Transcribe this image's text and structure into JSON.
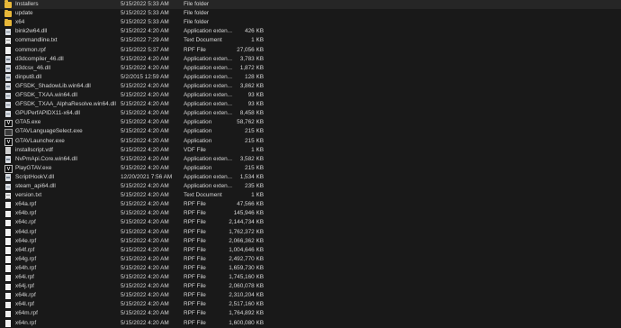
{
  "files": [
    {
      "name": "Installers",
      "date": "5/15/2022 5:33 AM",
      "type": "File folder",
      "size": "",
      "icon": "folder-icon"
    },
    {
      "name": "update",
      "date": "5/15/2022 5:33 AM",
      "type": "File folder",
      "size": "",
      "icon": "folder-icon"
    },
    {
      "name": "x64",
      "date": "5/15/2022 5:33 AM",
      "type": "File folder",
      "size": "",
      "icon": "folder-icon"
    },
    {
      "name": "bink2w64.dll",
      "date": "5/15/2022 4:20 AM",
      "type": "Application exten...",
      "size": "426 KB",
      "icon": "dll-file-icon"
    },
    {
      "name": "commandline.txt",
      "date": "5/15/2022 7:29 AM",
      "type": "Text Document",
      "size": "1 KB",
      "icon": "text-file-icon"
    },
    {
      "name": "common.rpf",
      "date": "5/15/2022 5:37 AM",
      "type": "RPF File",
      "size": "27,056 KB",
      "icon": "rpf-file-icon"
    },
    {
      "name": "d3dcompiler_46.dll",
      "date": "5/15/2022 4:20 AM",
      "type": "Application exten...",
      "size": "3,783 KB",
      "icon": "dll-file-icon"
    },
    {
      "name": "d3dcsx_46.dll",
      "date": "5/15/2022 4:20 AM",
      "type": "Application exten...",
      "size": "1,872 KB",
      "icon": "dll-file-icon"
    },
    {
      "name": "dinput8.dll",
      "date": "5/2/2015 12:59 AM",
      "type": "Application exten...",
      "size": "128 KB",
      "icon": "dll-file-icon"
    },
    {
      "name": "GFSDK_ShadowLib.win64.dll",
      "date": "5/15/2022 4:20 AM",
      "type": "Application exten...",
      "size": "3,862 KB",
      "icon": "dll-file-icon"
    },
    {
      "name": "GFSDK_TXAA.win64.dll",
      "date": "5/15/2022 4:20 AM",
      "type": "Application exten...",
      "size": "93 KB",
      "icon": "dll-file-icon"
    },
    {
      "name": "GFSDK_TXAA_AlphaResolve.win64.dll",
      "date": "5/15/2022 4:20 AM",
      "type": "Application exten...",
      "size": "93 KB",
      "icon": "dll-file-icon"
    },
    {
      "name": "GPUPerfAPIDX11-x64.dll",
      "date": "5/15/2022 4:20 AM",
      "type": "Application exten...",
      "size": "8,458 KB",
      "icon": "dll-file-icon"
    },
    {
      "name": "GTA5.exe",
      "date": "5/15/2022 4:20 AM",
      "type": "Application",
      "size": "58,762 KB",
      "icon": "gta-app-icon"
    },
    {
      "name": "GTAVLanguageSelect.exe",
      "date": "5/15/2022 4:20 AM",
      "type": "Application",
      "size": "215 KB",
      "icon": "exe-file-icon"
    },
    {
      "name": "GTAVLauncher.exe",
      "date": "5/15/2022 4:20 AM",
      "type": "Application",
      "size": "215 KB",
      "icon": "gta-app-icon"
    },
    {
      "name": "installscript.vdf",
      "date": "5/15/2022 4:20 AM",
      "type": "VDF File",
      "size": "1 KB",
      "icon": "vdf-file-icon"
    },
    {
      "name": "NvPmApi.Core.win64.dll",
      "date": "5/15/2022 4:20 AM",
      "type": "Application exten...",
      "size": "3,582 KB",
      "icon": "dll-file-icon"
    },
    {
      "name": "PlayGTAV.exe",
      "date": "5/15/2022 4:20 AM",
      "type": "Application",
      "size": "215 KB",
      "icon": "gta-app-icon"
    },
    {
      "name": "ScriptHookV.dll",
      "date": "12/20/2021 7:56 AM",
      "type": "Application exten...",
      "size": "1,534 KB",
      "icon": "dll-file-icon"
    },
    {
      "name": "steam_api64.dll",
      "date": "5/15/2022 4:20 AM",
      "type": "Application exten...",
      "size": "235 KB",
      "icon": "dll-file-icon"
    },
    {
      "name": "version.txt",
      "date": "5/15/2022 4:20 AM",
      "type": "Text Document",
      "size": "1 KB",
      "icon": "text-file-icon"
    },
    {
      "name": "x64a.rpf",
      "date": "5/15/2022 4:20 AM",
      "type": "RPF File",
      "size": "47,566 KB",
      "icon": "rpf-file-icon"
    },
    {
      "name": "x64b.rpf",
      "date": "5/15/2022 4:20 AM",
      "type": "RPF File",
      "size": "145,946 KB",
      "icon": "rpf-file-icon"
    },
    {
      "name": "x64c.rpf",
      "date": "5/15/2022 4:20 AM",
      "type": "RPF File",
      "size": "2,144,734 KB",
      "icon": "rpf-file-icon"
    },
    {
      "name": "x64d.rpf",
      "date": "5/15/2022 4:20 AM",
      "type": "RPF File",
      "size": "1,762,372 KB",
      "icon": "rpf-file-icon"
    },
    {
      "name": "x64e.rpf",
      "date": "5/15/2022 4:20 AM",
      "type": "RPF File",
      "size": "2,066,362 KB",
      "icon": "rpf-file-icon"
    },
    {
      "name": "x64f.rpf",
      "date": "5/15/2022 4:20 AM",
      "type": "RPF File",
      "size": "1,004,646 KB",
      "icon": "rpf-file-icon"
    },
    {
      "name": "x64g.rpf",
      "date": "5/15/2022 4:20 AM",
      "type": "RPF File",
      "size": "2,492,770 KB",
      "icon": "rpf-file-icon"
    },
    {
      "name": "x64h.rpf",
      "date": "5/15/2022 4:20 AM",
      "type": "RPF File",
      "size": "1,659,730 KB",
      "icon": "rpf-file-icon"
    },
    {
      "name": "x64i.rpf",
      "date": "5/15/2022 4:20 AM",
      "type": "RPF File",
      "size": "1,745,160 KB",
      "icon": "rpf-file-icon"
    },
    {
      "name": "x64j.rpf",
      "date": "5/15/2022 4:20 AM",
      "type": "RPF File",
      "size": "2,060,078 KB",
      "icon": "rpf-file-icon"
    },
    {
      "name": "x64k.rpf",
      "date": "5/15/2022 4:20 AM",
      "type": "RPF File",
      "size": "2,310,204 KB",
      "icon": "rpf-file-icon"
    },
    {
      "name": "x64l.rpf",
      "date": "5/15/2022 4:20 AM",
      "type": "RPF File",
      "size": "2,517,160 KB",
      "icon": "rpf-file-icon"
    },
    {
      "name": "x64m.rpf",
      "date": "5/15/2022 4:20 AM",
      "type": "RPF File",
      "size": "1,764,892 KB",
      "icon": "rpf-file-icon"
    },
    {
      "name": "x64n.rpf",
      "date": "5/15/2022 4:20 AM",
      "type": "RPF File",
      "size": "1,600,080 KB",
      "icon": "rpf-file-icon"
    }
  ]
}
